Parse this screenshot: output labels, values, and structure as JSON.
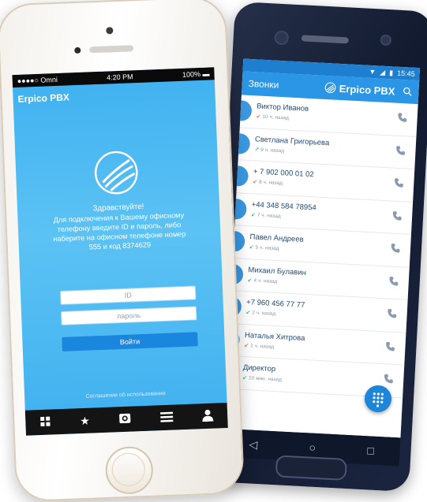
{
  "android": {
    "status": {
      "time": "15:45"
    },
    "appbar": {
      "title": "Звонки",
      "brand": "Erpico PBX"
    },
    "calls": [
      {
        "name": "Виктор Иванов",
        "time": "10 ч. назад",
        "dir": "in",
        "color": "#e74c3c"
      },
      {
        "name": "Светлана Григорьева",
        "time": "9 ч. назад",
        "dir": "out",
        "color": "#27ae60"
      },
      {
        "name": "+ 7 902 000 01 02",
        "time": "8 ч. назад",
        "dir": "in",
        "color": "#e74c3c"
      },
      {
        "name": "+44 348 584 78954",
        "time": "7 ч. назад",
        "dir": "in",
        "color": "#27ae60"
      },
      {
        "name": "Павел Андреев",
        "time": "5 ч. назад",
        "dir": "in",
        "color": "#27ae60"
      },
      {
        "name": "Михаил Булавин",
        "time": "4 ч. назад",
        "dir": "in",
        "color": "#27ae60"
      },
      {
        "name": "+7 960 456 77 77",
        "time": "2 ч. назад",
        "dir": "in",
        "color": "#27ae60"
      },
      {
        "name": "Наталья Хитрова",
        "time": "1 ч. назад",
        "dir": "in",
        "color": "#e74c3c"
      },
      {
        "name": "Директор",
        "time": "10 мин. назад",
        "dir": "in",
        "color": "#27ae60"
      }
    ],
    "nav": {
      "back": "◁",
      "home": "○",
      "recent": "□"
    }
  },
  "iphone": {
    "status": {
      "carrier": "●●●●○ Omni",
      "time": "4:20 PM",
      "battery": "100%"
    },
    "title": "Erpico PBX",
    "greeting": {
      "hello": "Здравствуйте!",
      "line1": "Для подключения к Вашему офисному",
      "line2": "телефону введите ID и пароль, либо",
      "line3": "наберите на офисном телефоне номер",
      "line4": "555 и код 8374629"
    },
    "form": {
      "id_placeholder": "ID",
      "password_placeholder": "пароль",
      "login_label": "Войти"
    },
    "agreement": "Соглашение об использовании",
    "tabs": [
      "grid-icon",
      "star-icon",
      "camera-icon",
      "menu-icon",
      "user-icon"
    ]
  }
}
